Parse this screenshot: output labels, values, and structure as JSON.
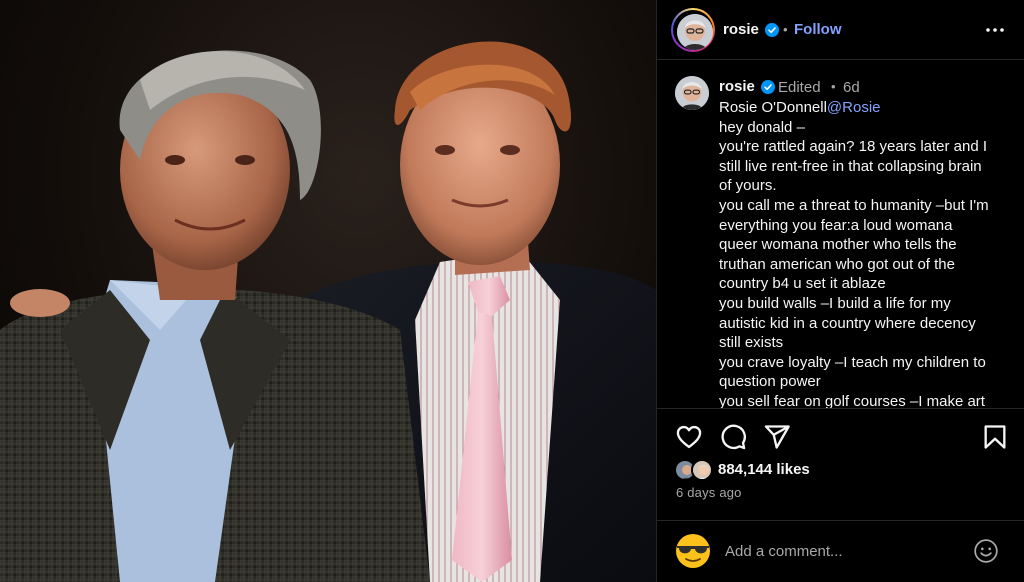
{
  "post": {
    "image_alt": "Photo of two men in suits",
    "colors": {
      "accent_blue": "#85a1ff",
      "verified_blue": "#0095f6",
      "bg": "#000000",
      "secondary_text": "#a8a8a8"
    }
  },
  "header": {
    "username": "rosie",
    "separator": "•",
    "follow_label": "Follow",
    "more_icon": "more-horizontal-icon"
  },
  "caption": {
    "username": "rosie",
    "edited_label": "Edited",
    "separator": "•",
    "time": "6d",
    "lines": [
      [
        "Rosie O'Donnell",
        "@Rosie"
      ],
      "hey donald –",
      "you're rattled again? 18 years later and I",
      "still live rent-free in that collapsing brain",
      "of yours.",
      "you call me a threat to humanity –but I'm",
      "everything you fear:a loud womana",
      "queer womana mother who tells the",
      "truthan american who got out of the",
      "country b4 u set it ablaze",
      "you build walls –I build a life for my",
      "autistic kid in a country where decency",
      "still exists",
      "you crave loyalty –I teach my children to",
      "question power",
      "you sell fear on golf courses –I make art"
    ]
  },
  "actions": {
    "like_icon": "heart-icon",
    "comment_icon": "comment-bubble-icon",
    "share_icon": "paper-plane-icon",
    "save_icon": "bookmark-icon",
    "likes_text": "884,144 likes",
    "time_ago": "6 days ago"
  },
  "comment": {
    "placeholder": "Add a comment...",
    "emoji_icon": "sunglasses-emoji-icon",
    "smiley_icon": "smiley-icon"
  }
}
